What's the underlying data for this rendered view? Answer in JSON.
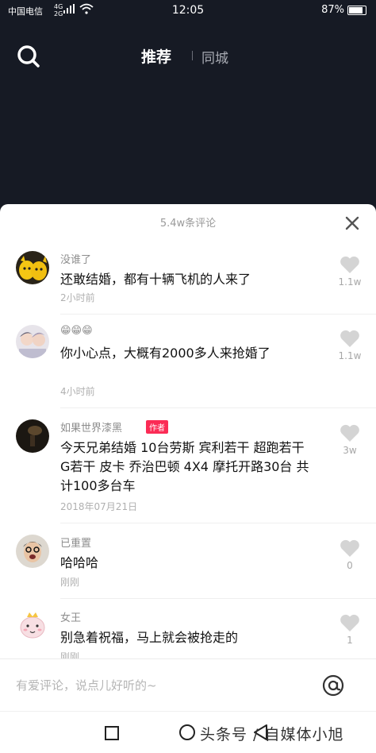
{
  "status_bar": {
    "carrier": "中国电信",
    "network_top": "4G",
    "network_bottom": "2G",
    "time": "12:05",
    "battery": "87%"
  },
  "top_nav": {
    "tab_recommended": "推荐",
    "tab_local": "同城",
    "search_icon": "search-icon"
  },
  "comments_sheet": {
    "title": "5.4w条评论",
    "close_icon": "close-icon",
    "comments": [
      {
        "user": "没谁了",
        "text": "还敢结婚，都有十辆飞机的人来了",
        "time": "2小时前",
        "likes": "1.1w"
      },
      {
        "user": "😁😁😁",
        "text": "你小心点，大概有2000多人来抢婚了",
        "time": "4小时前",
        "likes": "1.1w"
      },
      {
        "user": "如果世界漆黑",
        "author_tag": "作者",
        "text": "今天兄弟结婚 10台劳斯 宾利若干 超跑若干 G若干 皮卡 乔治巴顿 4X4 摩托开路30台 共计100多台车",
        "time": "2018年07月21日",
        "likes": "3w"
      },
      {
        "user": "已重置",
        "text": "哈哈哈",
        "time": "刚刚",
        "likes": "0"
      },
      {
        "user": "女王",
        "text": "别急着祝福，马上就会被抢走的",
        "time": "刚刚",
        "likes": "1"
      }
    ]
  },
  "input_bar": {
    "placeholder": "有爱评论，说点儿好听的~",
    "at_icon": "at-icon"
  },
  "watermark": "头条号 / 自媒体小旭"
}
